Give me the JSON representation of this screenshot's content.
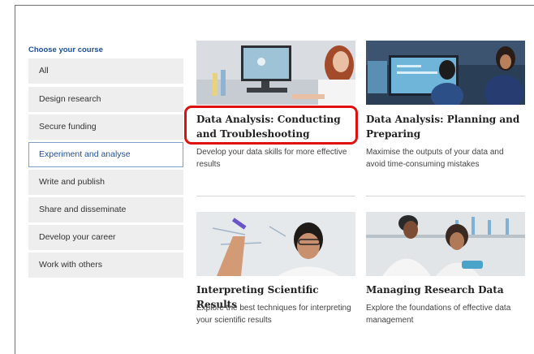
{
  "sidebar": {
    "heading": "Choose your course",
    "items": [
      {
        "label": "All"
      },
      {
        "label": "Design research"
      },
      {
        "label": "Secure funding"
      },
      {
        "label": "Experiment and analyse"
      },
      {
        "label": "Write and publish"
      },
      {
        "label": "Share and disseminate"
      },
      {
        "label": "Develop your career"
      },
      {
        "label": "Work with others"
      }
    ],
    "active": "Experiment and analyse"
  },
  "courses": [
    {
      "title": "Data Analysis: Conducting and Troubleshooting",
      "description": "Develop your data skills for more effective results",
      "highlighted": true
    },
    {
      "title": "Data Analysis: Planning and Preparing",
      "description": "Maximise the outputs of your data and avoid time-consuming mistakes"
    },
    {
      "title": "Interpreting Scientific Results",
      "description": "Explore the best techniques for interpreting your scientific results"
    },
    {
      "title": "Managing Research Data",
      "description": "Explore the foundations of effective data management"
    }
  ],
  "colors": {
    "accent": "#1f4f9b",
    "highlight": "#e01010",
    "sidebar_bg": "#eeeeee"
  }
}
